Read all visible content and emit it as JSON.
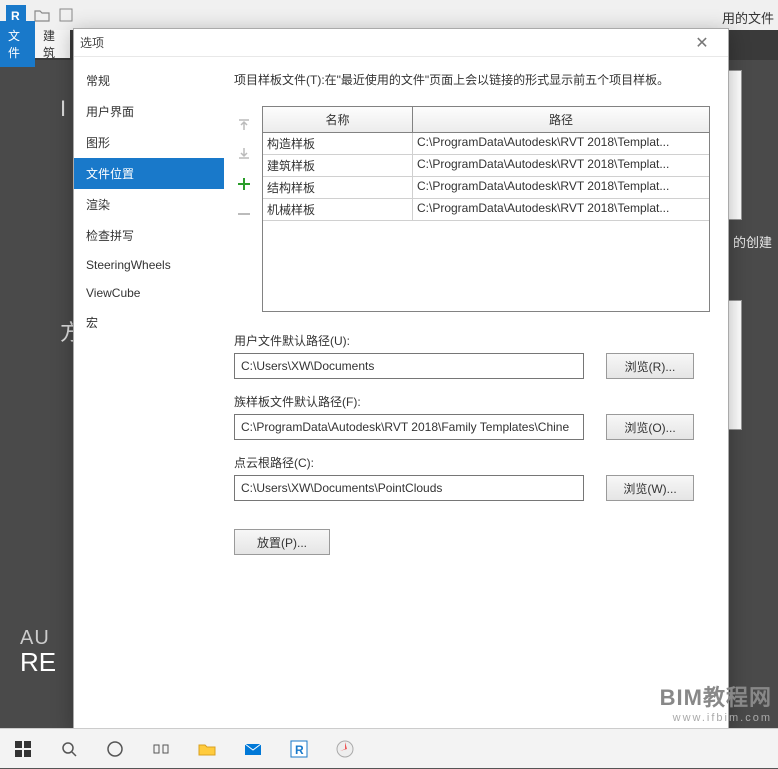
{
  "bg": {
    "file_tab": "文件",
    "arch_tab": "建筑",
    "right_partial": "用的文件",
    "right_create": "的创建",
    "auto": "AU",
    "rev": "RE"
  },
  "dialog": {
    "title": "选项",
    "close_glyph": "✕",
    "nav": [
      {
        "label": "常规",
        "selected": false
      },
      {
        "label": "用户界面",
        "selected": false
      },
      {
        "label": "图形",
        "selected": false
      },
      {
        "label": "文件位置",
        "selected": true
      },
      {
        "label": "渲染",
        "selected": false
      },
      {
        "label": "检查拼写",
        "selected": false
      },
      {
        "label": "SteeringWheels",
        "selected": false
      },
      {
        "label": "ViewCube",
        "selected": false
      },
      {
        "label": "宏",
        "selected": false
      }
    ],
    "desc": "项目样板文件(T):在\"最近使用的文件\"页面上会以链接的形式显示前五个项目样板。",
    "grid": {
      "headers": {
        "name": "名称",
        "path": "路径"
      },
      "rows": [
        {
          "name": "构造样板",
          "path": "C:\\ProgramData\\Autodesk\\RVT 2018\\Templat..."
        },
        {
          "name": "建筑样板",
          "path": "C:\\ProgramData\\Autodesk\\RVT 2018\\Templat..."
        },
        {
          "name": "结构样板",
          "path": "C:\\ProgramData\\Autodesk\\RVT 2018\\Templat..."
        },
        {
          "name": "机械样板",
          "path": "C:\\ProgramData\\Autodesk\\RVT 2018\\Templat..."
        }
      ]
    },
    "fields": {
      "user_path_label": "用户文件默认路径(U):",
      "user_path_value": "C:\\Users\\XW\\Documents",
      "browse_r": "浏览(R)...",
      "family_path_label": "族样板文件默认路径(F):",
      "family_path_value": "C:\\ProgramData\\Autodesk\\RVT 2018\\Family Templates\\Chine",
      "browse_o": "浏览(O)...",
      "cloud_path_label": "点云根路径(C):",
      "cloud_path_value": "C:\\Users\\XW\\Documents\\PointClouds",
      "browse_w": "浏览(W)...",
      "place_btn": "放置(P)..."
    }
  },
  "watermark": {
    "line1": "BIM教程网",
    "line2": "www.ifbim.com"
  }
}
